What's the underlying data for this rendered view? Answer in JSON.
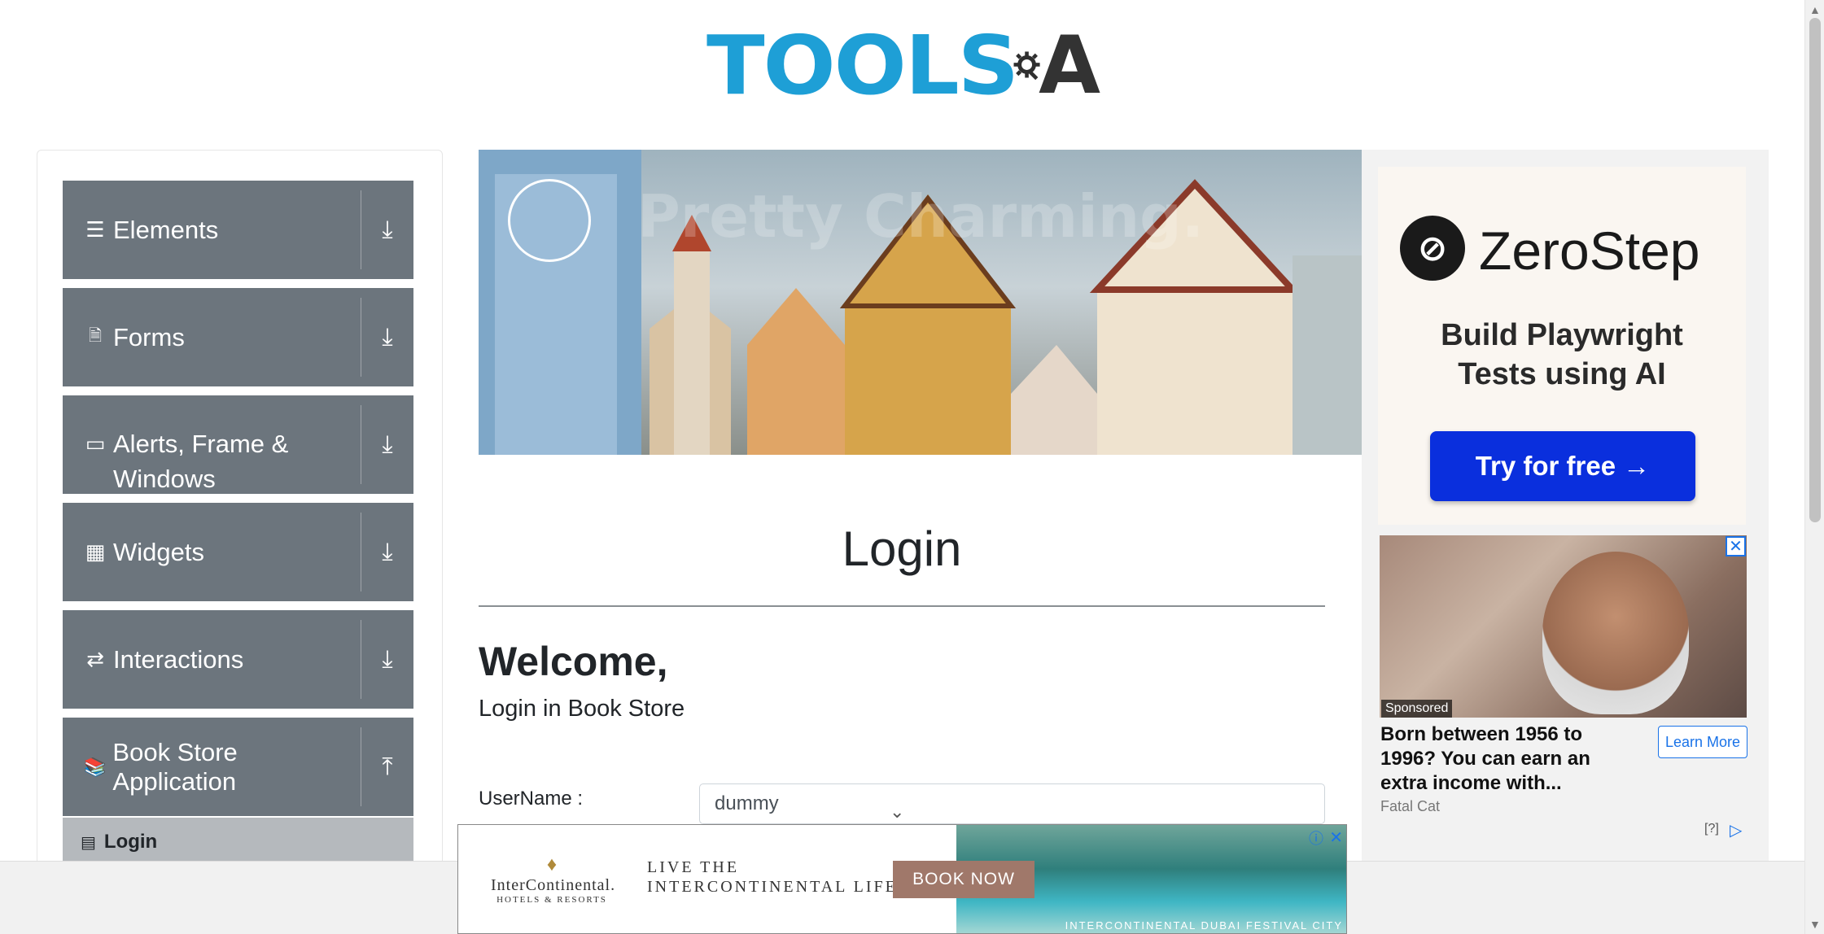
{
  "header": {
    "logo_tools": "TOOLS",
    "logo_a": "A"
  },
  "sidebar": {
    "groups": [
      {
        "label": "Elements",
        "icon": "hamburger-icon",
        "icon_glyph": "☰",
        "arrow": "⤓"
      },
      {
        "label": "Forms",
        "icon": "document-icon",
        "icon_glyph": "🗎",
        "arrow": "⤓"
      },
      {
        "label": "Alerts, Frame &",
        "label2": "Windows",
        "icon": "window-icon",
        "icon_glyph": "▭",
        "arrow": "⤓"
      },
      {
        "label": "Widgets",
        "icon": "widgets-icon",
        "icon_glyph": "▦",
        "arrow": "⤓"
      },
      {
        "label": "Interactions",
        "icon": "interactions-icon",
        "icon_glyph": "⇄",
        "arrow": "⤓"
      },
      {
        "label": "Book Store Application",
        "icon": "books-icon",
        "icon_glyph": "📚",
        "arrow": "⤒"
      }
    ],
    "active_item": {
      "label": "Login",
      "icon": "login-icon",
      "icon_glyph": "▤"
    }
  },
  "banner": {
    "overlay_text": "Pretty Charming."
  },
  "main": {
    "heading": "Login",
    "welcome": "Welcome,",
    "welcome_sub": "Login in Book Store",
    "username_label": "UserName :",
    "username_value": "dummy"
  },
  "ads": {
    "zerostep": {
      "brand": "ZeroStep",
      "tagline_1": "Build Playwright",
      "tagline_2": "Tests using AI",
      "cta": "Try for free →"
    },
    "sponsored": {
      "badge": "Sponsored",
      "headline": "Born between 1956 to 1996? You can earn an extra income with...",
      "cta": "Learn More",
      "source": "Fatal Cat",
      "help": "[?]"
    },
    "bottom": {
      "logo_name": "InterContinental.",
      "logo_sub": "HOTELS & RESORTS",
      "tagline_1": "LIVE THE",
      "tagline_2": "INTERCONTINENTAL LIFE",
      "cta": "BOOK NOW",
      "caption": "INTERCONTINENTAL DUBAI FESTIVAL CITY"
    }
  },
  "colors": {
    "sidebar_bg": "#6c757d",
    "logo_blue": "#1e9fd6",
    "cta_blue": "#0a2fdd"
  }
}
